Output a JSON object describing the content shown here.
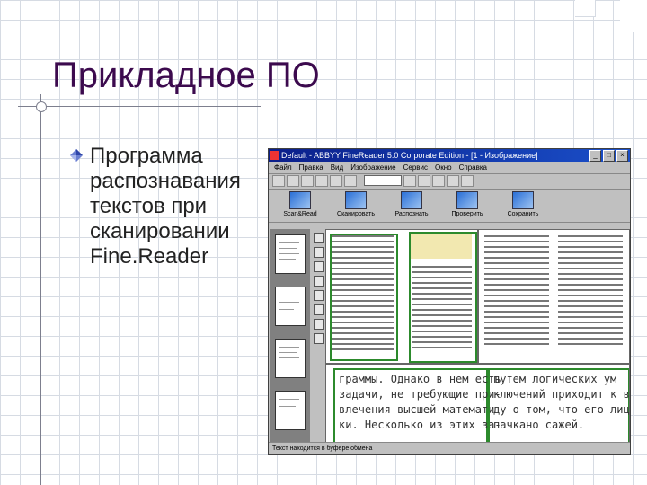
{
  "slide": {
    "title": "Прикладное ПО",
    "bullet": "Программа\nраспознавания\nтекстов при\nсканировании\nFine.Reader"
  },
  "screenshot": {
    "window_title": "Default - ABBYY FineReader 5.0 Corporate Edition - [1 - Изображение]",
    "menu": [
      "Файл",
      "Правка",
      "Вид",
      "Изображение",
      "Сервис",
      "Окно",
      "Справка"
    ],
    "big_tools": [
      "Scan&Read",
      "Сканировать",
      "Распознать",
      "Проверить",
      "Сохранить"
    ],
    "zoom_left": "граммы. Однако в нем есть\nзадачи, не требующие при-\nвлечения высшей математи-\nки. Несколько из этих за-",
    "zoom_right": "путем логических ум\nключений приходит к в\nду о том, что его лицо\nпачкано сажей.",
    "status": "Текст находится в буфере обмена"
  },
  "colors": {
    "title": "#3c0a4e",
    "grid": "#d6dbe3",
    "titlebar": "#0b1f8a",
    "block_border": "#2c8a2c"
  },
  "icons": {
    "bullet": "blue-diamond-icon",
    "window": "finereader-app-icon"
  }
}
